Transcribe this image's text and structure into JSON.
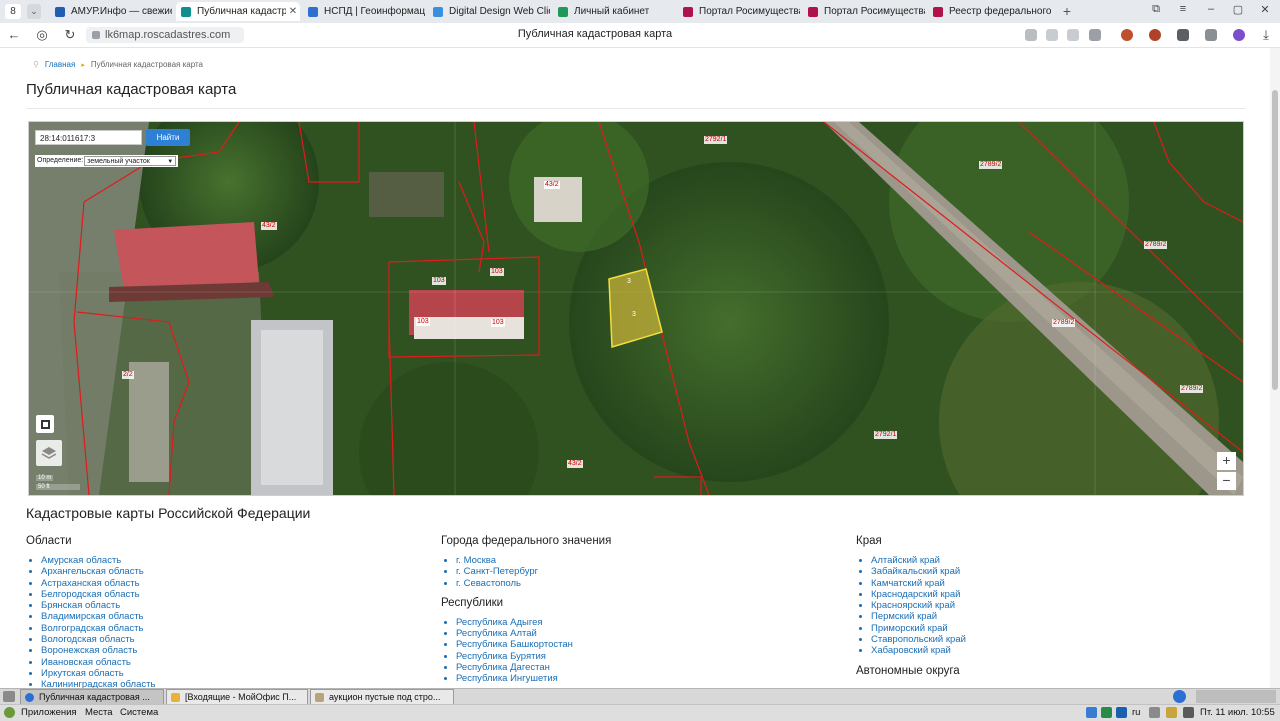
{
  "browser": {
    "tab_count": "8",
    "tabs": [
      {
        "title": "АМУР.Инфо — свежие",
        "color": "#1f5fb3"
      },
      {
        "title": "Публичная кадастро",
        "color": "#0f8f8f",
        "active": true
      },
      {
        "title": "НСПД | Геоинформаци",
        "color": "#2f6fd0"
      },
      {
        "title": "Digital Design Web Clie",
        "color": "#3b8fe0"
      },
      {
        "title": "Личный кабинет",
        "color": "#1d9a5a"
      },
      {
        "title": "Портал Росимущества",
        "color": "#b0124a"
      },
      {
        "title": "Портал Росимущества",
        "color": "#b0124a"
      },
      {
        "title": "Реестр федерального",
        "color": "#b0124a"
      }
    ],
    "url": "lk6map.roscadastres.com",
    "page_title": "Публичная кадастровая карта"
  },
  "breadcrumb": {
    "home": "Главная",
    "current": "Публичная кадастровая карта"
  },
  "page_heading": "Публичная кадастровая карта",
  "map": {
    "search_value": "28:14:011617:3",
    "search_button": "Найти",
    "definition_label": "Определение:",
    "definition_value": "земельный участок",
    "scale_top": "10 m",
    "scale_bottom": "50 ft",
    "zoom_in": "+",
    "zoom_out": "−",
    "parcel_labels": [
      "2792/1",
      "2789/2",
      "43/2",
      "43/2",
      "103",
      "103",
      "103",
      "103",
      "2789/2",
      "2789/2",
      "2/2",
      "2789/2",
      "2792/1",
      "43/2",
      "3",
      "3"
    ]
  },
  "regions": {
    "title": "Кадастровые карты Российской Федерации",
    "oblasti": {
      "heading": "Области",
      "items": [
        "Амурская область",
        "Архангельская область",
        "Астраханская область",
        "Белгородская область",
        "Брянская область",
        "Владимирская область",
        "Волгоградская область",
        "Вологодская область",
        "Воронежская область",
        "Ивановская область",
        "Иркутская область",
        "Калининградская область"
      ]
    },
    "cities": {
      "heading": "Города федерального значения",
      "items": [
        "г. Москва",
        "г. Санкт-Петербург",
        "г. Севастополь"
      ]
    },
    "republics": {
      "heading": "Республики",
      "items": [
        "Республика Адыгея",
        "Республика Алтай",
        "Республика Башкортостан",
        "Республика Бурятия",
        "Республика Дагестан",
        "Республика Ингушетия"
      ]
    },
    "kraya": {
      "heading": "Края",
      "items": [
        "Алтайский край",
        "Забайкальский край",
        "Камчатский край",
        "Краснодарский край",
        "Красноярский край",
        "Пермский край",
        "Приморский край",
        "Ставропольский край",
        "Хабаровский край"
      ]
    },
    "okruga": {
      "heading": "Автономные округа"
    }
  },
  "taskbar": {
    "windows": [
      "Публичная кадастровая ...",
      "[Входящие - МойОфис П...",
      "аукцион пустые под стро..."
    ]
  },
  "panel": {
    "menu_apps": "Приложения",
    "menu_places": "Места",
    "menu_system": "Система",
    "keyboard_layout": "ru",
    "clock": "Пт. 11 июл. 10:55"
  }
}
